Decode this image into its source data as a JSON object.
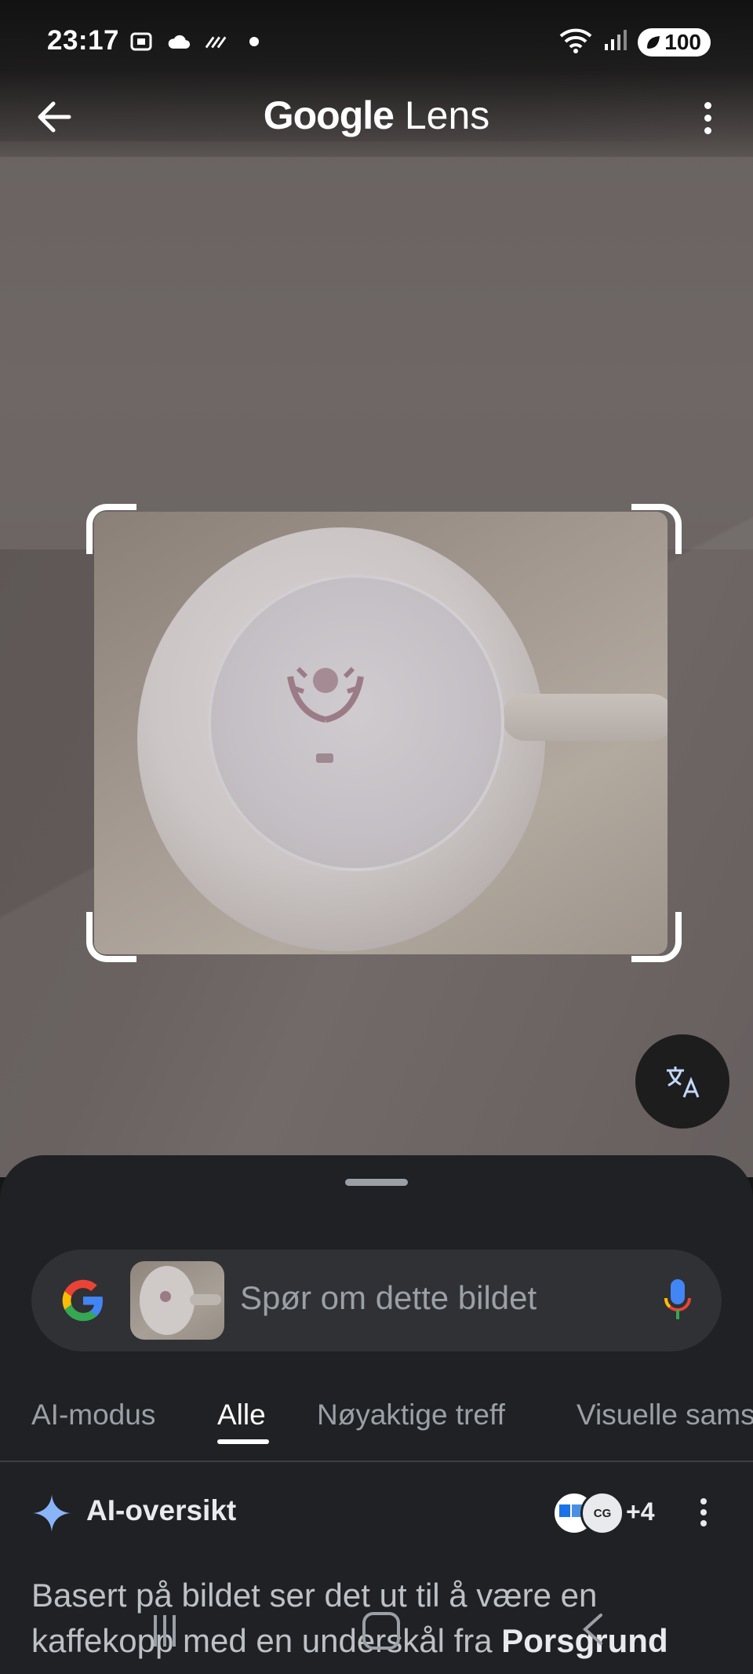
{
  "status_bar": {
    "time": "23:17",
    "battery": "100",
    "icons_left": [
      "screenshot-icon",
      "cloud-icon",
      "stripes-icon",
      "dot-icon"
    ],
    "icons_right": [
      "wifi-icon",
      "signal-icon",
      "battery-icon"
    ]
  },
  "app_bar": {
    "title_brand": "Google",
    "title_product": "Lens",
    "back_icon": "arrow-back-icon",
    "menu_icon": "more-vert-icon"
  },
  "translate_button": {
    "icon": "translate-icon"
  },
  "search": {
    "placeholder": "Spør om dette bildet",
    "google_icon": "google-g-icon",
    "mic_icon": "mic-icon"
  },
  "tabs": [
    {
      "label": "AI-modus",
      "active": false
    },
    {
      "label": "Alle",
      "active": true
    },
    {
      "label": "Nøyaktige treff",
      "active": false
    },
    {
      "label": "Visuelle sams",
      "active": false
    }
  ],
  "ai_overview": {
    "title": "AI-oversikt",
    "sources_more": "+4",
    "source_badge_text": "CG",
    "text_plain": "Basert på bildet ser det ut til å være en kaffekopp med en underskål fra ",
    "text_bold": "Porsgrund"
  },
  "colors": {
    "sheet_bg": "#202124",
    "search_bg": "#303134",
    "active_tab": "#ffffff",
    "inactive_tab": "#9aa0a6",
    "spark_blue": "#8ab4f8"
  }
}
